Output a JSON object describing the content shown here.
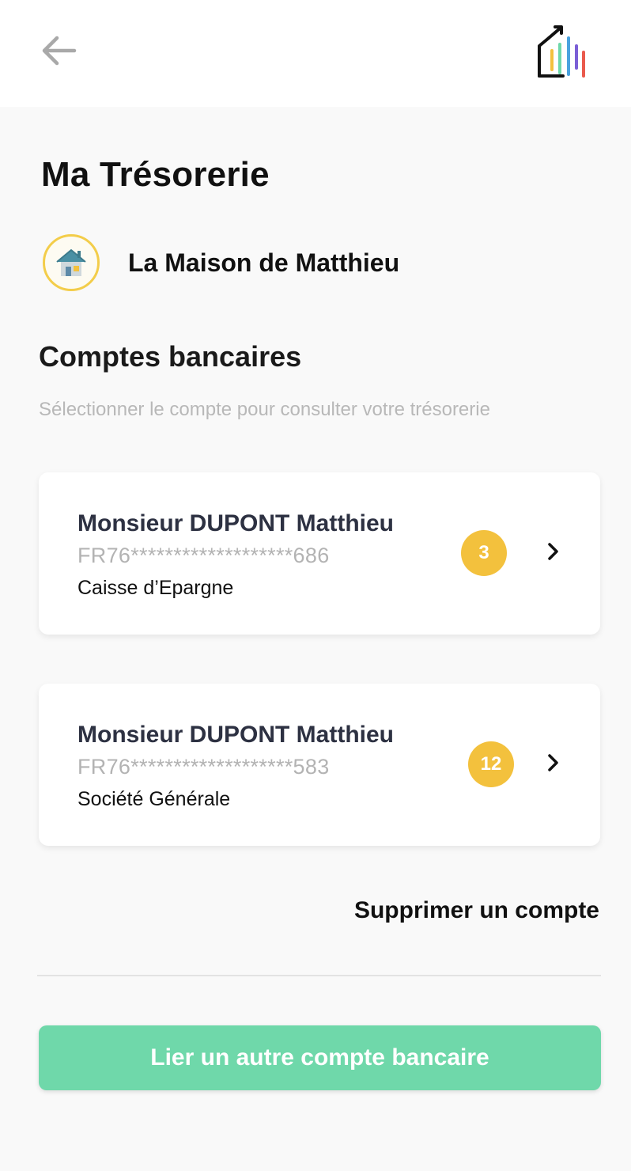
{
  "header": {
    "back_icon": "arrow-left-icon",
    "logo_icon": "house-chart-logo-icon"
  },
  "page_title": "Ma Trésorerie",
  "property": {
    "name": "La Maison de Matthieu",
    "icon": "house-icon"
  },
  "accounts_section": {
    "title": "Comptes bancaires",
    "subtitle": "Sélectionner le compte pour consulter votre trésorerie",
    "accounts": [
      {
        "holder": "Monsieur DUPONT Matthieu",
        "iban": "FR76*******************686",
        "bank": "Caisse d’Epargne",
        "badge": "3"
      },
      {
        "holder": "Monsieur DUPONT Matthieu",
        "iban": "FR76*******************583",
        "bank": "Société Générale",
        "badge": "12"
      }
    ]
  },
  "actions": {
    "delete_account": "Supprimer un compte",
    "link_account": "Lier un autre compte bancaire"
  },
  "colors": {
    "badge": "#f3c13d",
    "primary_button": "#6fd8aa",
    "avatar_ring": "#f3cd4a"
  }
}
